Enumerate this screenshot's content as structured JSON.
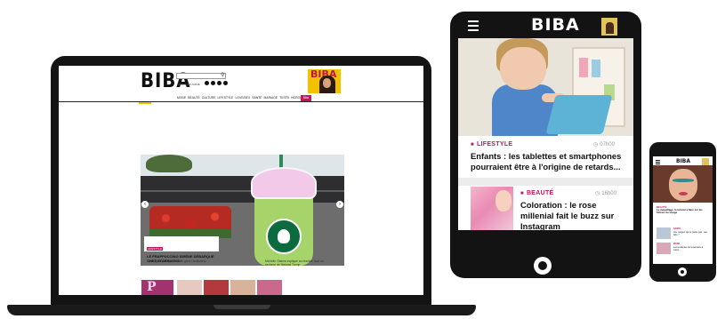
{
  "brand": {
    "logo": "BIBA",
    "accent": "#c2185b",
    "mag_accent": "#f2c200"
  },
  "laptop": {
    "header": {
      "logo": "BIBA",
      "search_placeholder": "",
      "small_link": "Abonnez-vous",
      "socials": [
        "facebook-icon",
        "twitter-icon",
        "pinterest-icon",
        "instagram-icon"
      ],
      "magazine_title": "BIBA"
    },
    "nav": {
      "items": [
        "MODE",
        "BEAUTÉ",
        "CULTURE",
        "LIFESTYLE",
        "LOVE/SEX",
        "SANTÉ",
        "MARIAGE",
        "TESTS",
        "HOROSCOPE"
      ],
      "badge": "Biba"
    },
    "carousel": {
      "tag": "LIFESTYLE",
      "title": "LE FRAPPUCCINO SIRÈNE DÉBARQUE CHEZ STARBUCKS !",
      "prev_icon": "chevron-left-icon",
      "next_icon": "chevron-right-icon"
    },
    "sub_left": "Une application pour mieux gérer l'ordinateur",
    "sub_right_1": "Michelle Obama explique sa réaction face au",
    "sub_right_2": "sexisme de Melania Trump",
    "tiles": {
      "brand_letter": "P"
    }
  },
  "tablet": {
    "logo": "BIBA",
    "menu_icon": "hamburger-icon",
    "cards": [
      {
        "category": "LIFESTYLE",
        "time": "07h00",
        "title": "Enfants : les tablettes et smartphones pourraient être à l'origine de retards..."
      },
      {
        "category": "BEAUTÉ",
        "time": "16h00",
        "title": "Coloration : le rose millenial fait le buzz sur Instagram"
      }
    ]
  },
  "phone": {
    "logo": "BIBA",
    "lead_category": "BEAUTÉ",
    "lead_title": "Le maquillage, le tutoriel a faire sur les Stories du visage",
    "rows": [
      {
        "category": "SANTÉ",
        "text": "Une rougeur qui ne passe pas : que faire ?"
      },
      {
        "category": "MODE",
        "text": "Les tendances de la semaine à suivre"
      }
    ]
  }
}
